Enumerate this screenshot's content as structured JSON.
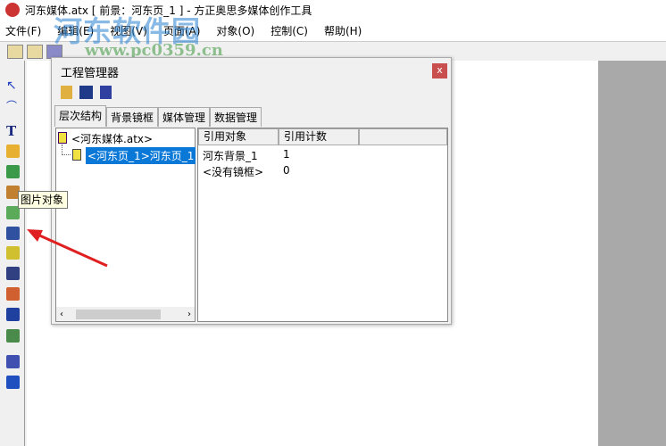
{
  "window": {
    "title": "河东媒体.atx [ 前景：河东页_1 ] - 方正奥思多媒体创作工具"
  },
  "watermark": {
    "name": "河东软件园",
    "url": "www.pc0359.cn"
  },
  "menu": [
    "文件(F)",
    "编辑(E)",
    "视图(V)",
    "页面(A)",
    "对象(O)",
    "控制(C)",
    "帮助(H)"
  ],
  "tooltip": "图片对象",
  "dialog": {
    "title": "工程管理器",
    "close": "x",
    "tabs": [
      "层次结构",
      "背景镜框",
      "媒体管理",
      "数据管理"
    ],
    "tree": {
      "root": "<河东媒体.atx>",
      "child": "<河东页_1>河东页_1"
    },
    "list": {
      "headers": [
        "引用对象",
        "引用计数"
      ],
      "rows": [
        {
          "name": "河东背景_1",
          "count": "1"
        },
        {
          "name": "<没有镜框>",
          "count": "0"
        }
      ]
    }
  },
  "colors": {
    "selection": "#0a78d7",
    "close": "#c94e4e",
    "arrow": "#e02020"
  }
}
